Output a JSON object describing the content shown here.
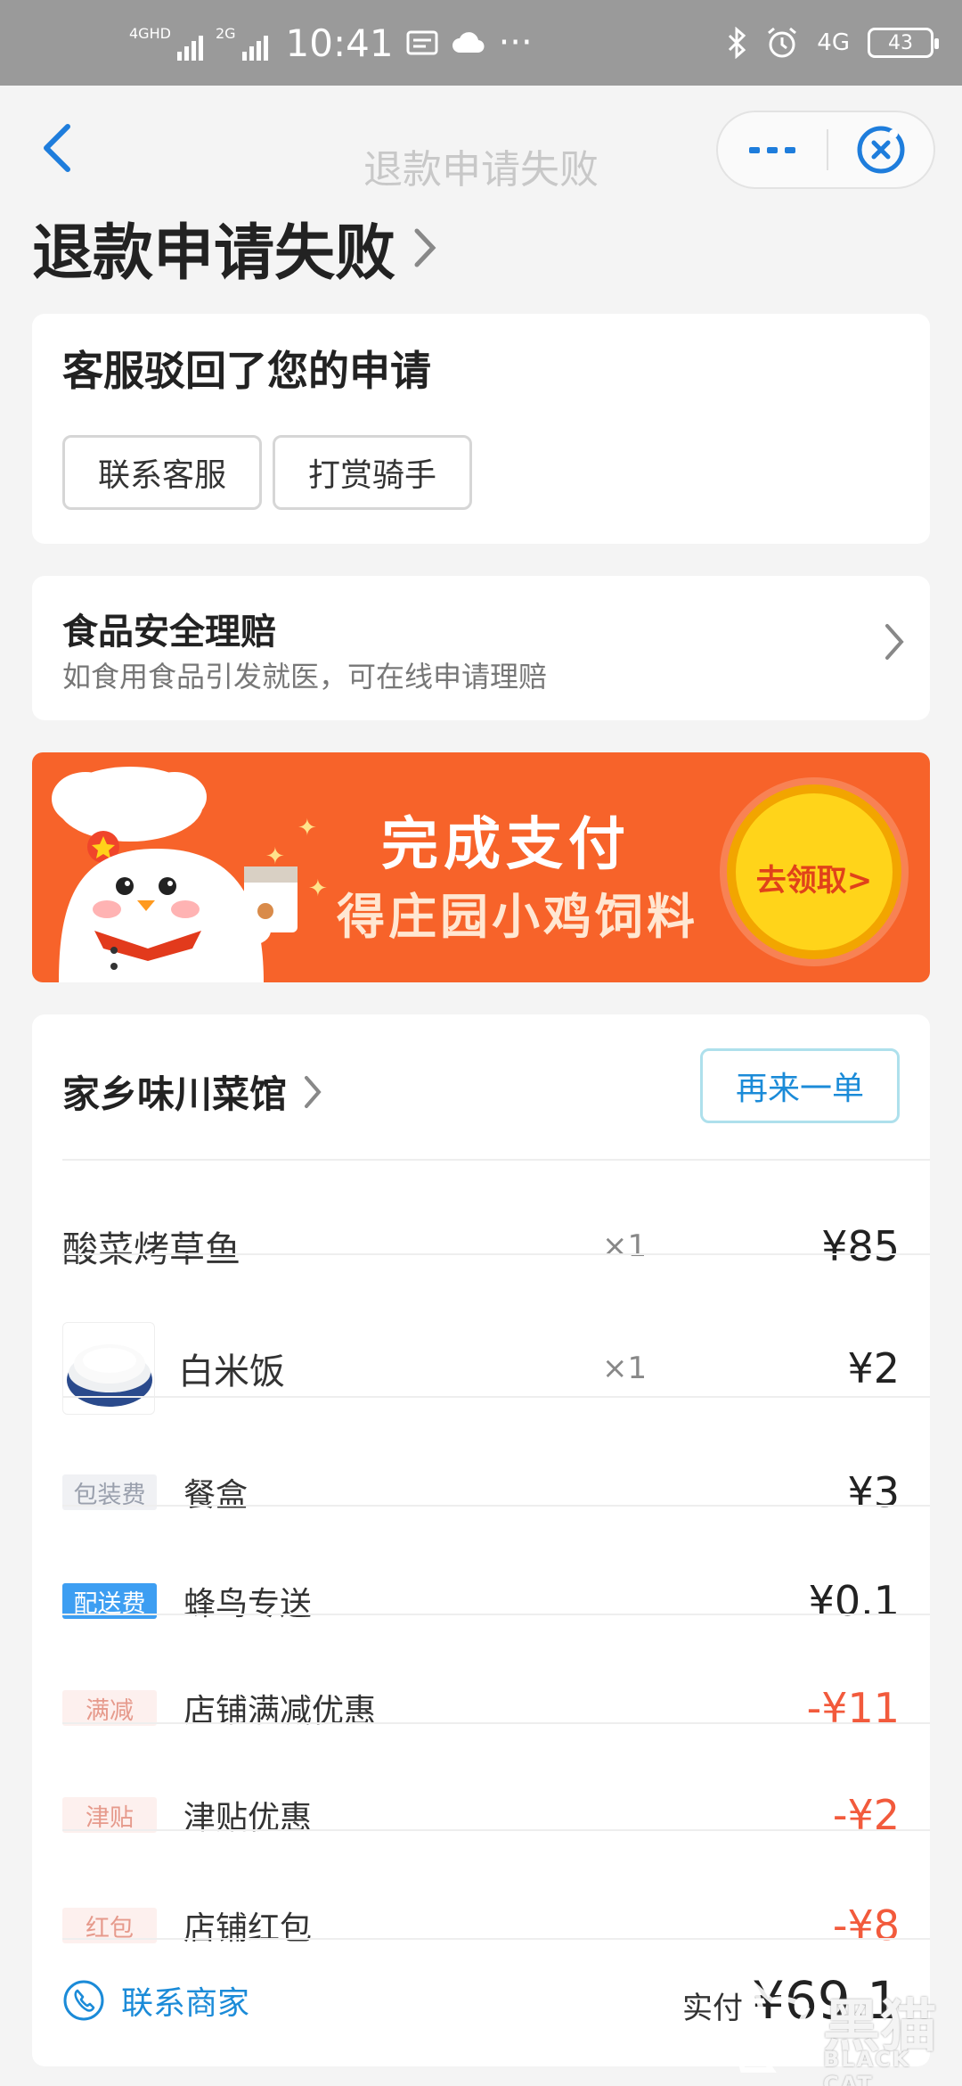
{
  "status_bar": {
    "net1": "4GHD",
    "net2": "2G",
    "time": "10:41",
    "more": "···",
    "net_right": "4G",
    "battery": "43",
    "icons": [
      "mail-icon",
      "cloud-icon",
      "bluetooth-icon",
      "alarm-icon"
    ]
  },
  "nav": {
    "title": "退款申请失败",
    "icons": [
      "back-icon",
      "more-icon",
      "close-icon"
    ]
  },
  "page": {
    "heading": "退款申请失败"
  },
  "rejection_card": {
    "title": "客服驳回了您的申请",
    "btn_contact": "联系客服",
    "btn_tip": "打赏骑手"
  },
  "claim_card": {
    "title": "食品安全理赔",
    "subtitle": "如食用食品引发就医，可在线申请理赔"
  },
  "banner": {
    "line1": "完成支付",
    "line2": "得庄园小鸡饲料",
    "cta": "去领取>",
    "bg_color": "#f7632a"
  },
  "order": {
    "shop_name": "家乡味川菜馆",
    "reorder": "再来一单",
    "items": [
      {
        "name": "酸菜烤草鱼",
        "qty": "×1",
        "price": "¥85"
      },
      {
        "name": "白米饭",
        "qty": "×1",
        "price": "¥2"
      }
    ],
    "fees": [
      {
        "tag": "包装费",
        "label": "餐盒",
        "amount": "¥3"
      },
      {
        "tag": "配送费",
        "label": "蜂鸟专送",
        "amount": "¥0.1"
      }
    ],
    "discounts": [
      {
        "tag": "满减",
        "label": "店铺满减优惠",
        "amount": "-¥11"
      },
      {
        "tag": "津贴",
        "label": "津贴优惠",
        "amount": "-¥2"
      },
      {
        "tag": "红包",
        "label": "店铺红包",
        "amount": "-¥8"
      }
    ],
    "contact_merchant": "联系商家",
    "paid_label": "实付",
    "paid_amount": "¥69.1",
    "accent_color": "#1b8bd8",
    "discount_color": "#f25a3c"
  },
  "watermark": {
    "cn": "黑猫",
    "en": "BLACK CAT"
  }
}
